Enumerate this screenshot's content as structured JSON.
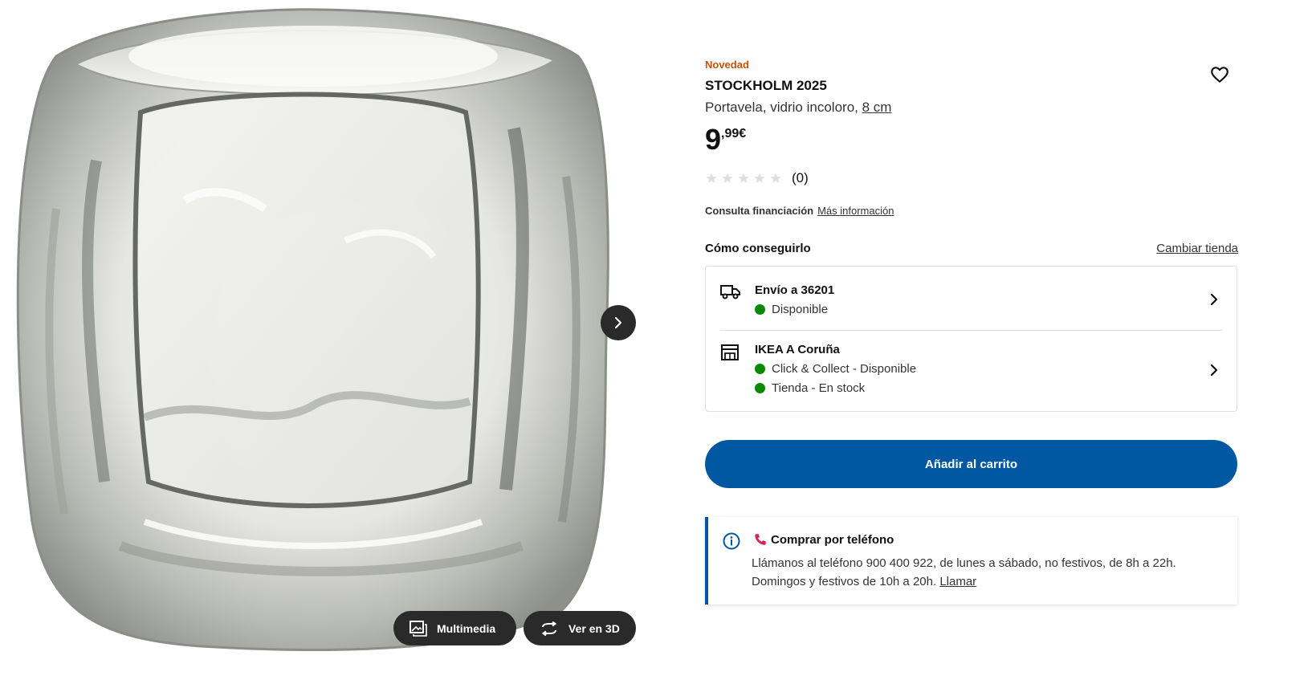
{
  "media": {
    "image_alt": "Portavela de vidrio incoloro STOCKHOLM 2025",
    "next_icon": "chevron-right-icon",
    "multimedia_label": "Multimedia",
    "multimedia_icon": "gallery-icon",
    "view3d_label": "Ver en 3D",
    "view3d_icon": "rotate-3d-icon"
  },
  "product": {
    "badge": "Novedad",
    "name": "STOCKHOLM 2025",
    "description": "Portavela, vidrio incoloro, ",
    "size_link": "8 cm",
    "price_int": "9",
    "price_dec": ",99€",
    "rating_value": 0,
    "rating_count": "(0)",
    "favorite_icon": "heart-icon"
  },
  "finance": {
    "label": "Consulta financiación",
    "link": "Más información"
  },
  "availability": {
    "title": "Cómo conseguirlo",
    "change_store": "Cambiar tienda",
    "delivery": {
      "title": "Envío a 36201",
      "status": "Disponible",
      "icon": "truck-icon"
    },
    "store": {
      "title": "IKEA A Coruña",
      "status_1": "Click & Collect - Disponible",
      "status_2": "Tienda - En stock",
      "icon": "store-icon"
    },
    "status_color": "#0a8a00"
  },
  "cart": {
    "label": "Añadir al carrito",
    "color": "#0058a3"
  },
  "phone": {
    "title": "Comprar por teléfono",
    "text": "Llámanos al teléfono 900 400 922, de lunes a sábado, no festivos, de 8h a 22h. Domingos y festivos de 10h a 20h. ",
    "link": "Llamar",
    "accent": "#0058a3"
  },
  "colors": {
    "badge": "#ca5008",
    "primary": "#0058a3"
  }
}
